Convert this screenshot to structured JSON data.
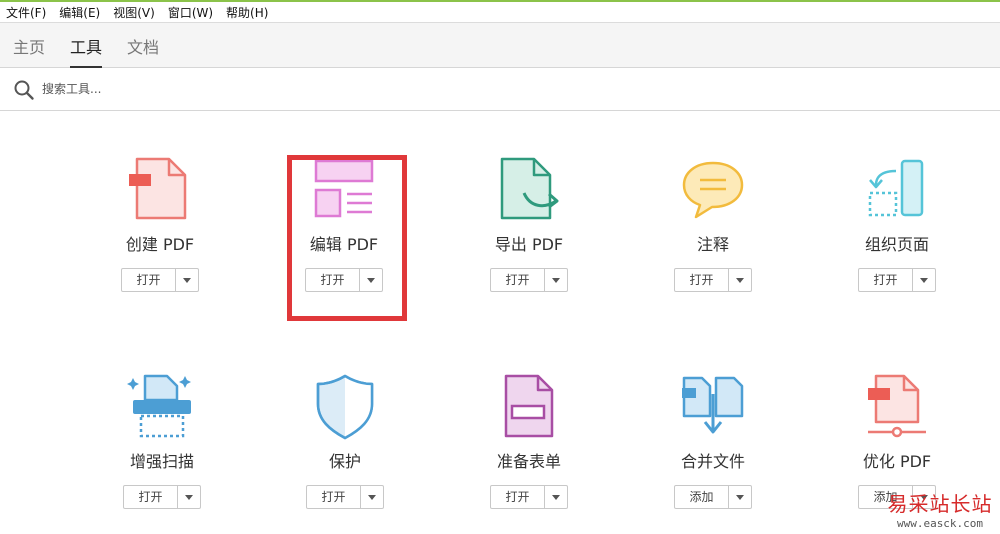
{
  "menu": [
    "文件(F)",
    "编辑(E)",
    "视图(V)",
    "窗口(W)",
    "帮助(H)"
  ],
  "tabs": [
    {
      "label": "主页",
      "active": false
    },
    {
      "label": "工具",
      "active": true
    },
    {
      "label": "文档",
      "active": false
    }
  ],
  "search": {
    "placeholder": "搜索工具..."
  },
  "tools": [
    {
      "label": "创建 PDF",
      "button": "打开",
      "icon": "create-pdf-icon"
    },
    {
      "label": "编辑 PDF",
      "button": "打开",
      "icon": "edit-pdf-icon"
    },
    {
      "label": "导出 PDF",
      "button": "打开",
      "icon": "export-pdf-icon"
    },
    {
      "label": "注释",
      "button": "打开",
      "icon": "comment-icon"
    },
    {
      "label": "组织页面",
      "button": "打开",
      "icon": "organize-pages-icon"
    },
    {
      "label": "增强扫描",
      "button": "打开",
      "icon": "enhance-scan-icon"
    },
    {
      "label": "保护",
      "button": "打开",
      "icon": "protect-shield-icon"
    },
    {
      "label": "准备表单",
      "button": "打开",
      "icon": "prepare-form-icon"
    },
    {
      "label": "合并文件",
      "button": "添加",
      "icon": "combine-files-icon"
    },
    {
      "label": "优化 PDF",
      "button": "添加",
      "icon": "optimize-pdf-icon"
    }
  ],
  "watermark": {
    "text": "易采站长站",
    "url": "www.easck.com"
  },
  "colors": {
    "highlight": "#e0383a",
    "accent": "#8bc34a"
  }
}
